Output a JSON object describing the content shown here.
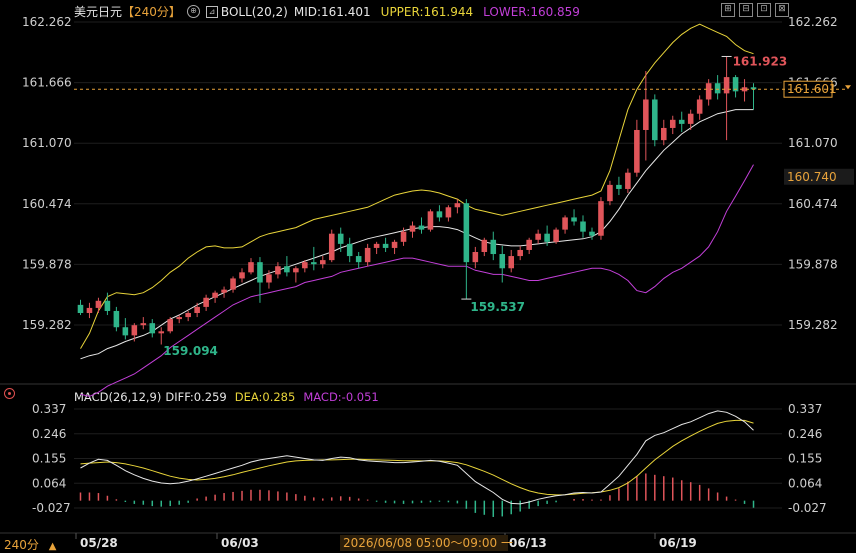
{
  "header": {
    "symbol": "美元日元",
    "period": "【240分】",
    "indicator": "BOLL(20,2)",
    "mid_label": "MID:",
    "mid_value": "161.401",
    "upper_label": "UPPER:",
    "upper_value": "161.944",
    "lower_label": "LOWER:",
    "lower_value": "160.859",
    "mid_color": "#e6e6e6",
    "upper_color": "#e8d43a",
    "lower_color": "#c23fd8"
  },
  "window_buttons": [
    "⊞",
    "⊟",
    "⊡",
    "⊠"
  ],
  "price_axis": {
    "ticks": [
      "162.262",
      "161.666",
      "161.070",
      "160.474",
      "159.878",
      "159.282"
    ],
    "tick_values": [
      162.262,
      161.666,
      161.07,
      160.474,
      159.878,
      159.282
    ],
    "current_price": "161.601",
    "lower_band_tag": "160.740"
  },
  "annotations": {
    "high": "161.923",
    "low_mid": "159.537",
    "low_left": "159.094"
  },
  "macd_header": {
    "name": "MACD(26,12,9)",
    "diff": "DIFF:0.259",
    "dea": "DEA:0.285",
    "macd": "MACD:-0.051"
  },
  "macd_axis": {
    "ticks": [
      "0.337",
      "0.246",
      "0.155",
      "0.064",
      "-0.027"
    ],
    "tick_values": [
      0.337,
      0.246,
      0.155,
      0.064,
      -0.027
    ]
  },
  "time_axis": {
    "labels": [
      "05/28",
      "06/03",
      "06/13",
      "06/19"
    ],
    "crosshair_label": "2026/06/08 05:00～09:00 一"
  },
  "bottom_left": {
    "period": "240分",
    "arrow": "▲"
  },
  "colors": {
    "up": "#e0555a",
    "down": "#2fb58a",
    "orange": "#e8a33b",
    "grid": "#1e1e1e"
  },
  "chart_data": {
    "type": "candlestick",
    "price_range": [
      159.0,
      162.3
    ],
    "candles": [
      [
        159.48,
        159.53,
        159.38,
        159.4
      ],
      [
        159.4,
        159.5,
        159.35,
        159.45
      ],
      [
        159.45,
        159.55,
        159.4,
        159.52
      ],
      [
        159.52,
        159.6,
        159.38,
        159.42
      ],
      [
        159.42,
        159.46,
        159.22,
        159.26
      ],
      [
        159.26,
        159.35,
        159.14,
        159.18
      ],
      [
        159.18,
        159.3,
        159.12,
        159.28
      ],
      [
        159.28,
        159.36,
        159.24,
        159.3
      ],
      [
        159.3,
        159.34,
        159.16,
        159.2
      ],
      [
        159.2,
        159.26,
        159.09,
        159.22
      ],
      [
        159.22,
        159.36,
        159.2,
        159.34
      ],
      [
        159.34,
        159.38,
        159.3,
        159.36
      ],
      [
        159.36,
        159.42,
        159.32,
        159.4
      ],
      [
        159.4,
        159.5,
        159.36,
        159.46
      ],
      [
        159.46,
        159.58,
        159.42,
        159.55
      ],
      [
        159.55,
        159.62,
        159.5,
        159.6
      ],
      [
        159.6,
        159.66,
        159.55,
        159.63
      ],
      [
        159.63,
        159.76,
        159.6,
        159.74
      ],
      [
        159.74,
        159.84,
        159.7,
        159.8
      ],
      [
        159.8,
        159.94,
        159.78,
        159.9
      ],
      [
        159.9,
        159.95,
        159.5,
        159.7
      ],
      [
        159.7,
        159.82,
        159.64,
        159.78
      ],
      [
        159.78,
        159.9,
        159.74,
        159.86
      ],
      [
        159.86,
        159.96,
        159.76,
        159.8
      ],
      [
        159.8,
        159.86,
        159.7,
        159.84
      ],
      [
        159.84,
        159.92,
        159.8,
        159.9
      ],
      [
        159.9,
        160.05,
        159.82,
        159.88
      ],
      [
        159.88,
        159.96,
        159.84,
        159.92
      ],
      [
        159.92,
        160.22,
        159.9,
        160.18
      ],
      [
        160.18,
        160.24,
        160.0,
        160.08
      ],
      [
        160.08,
        160.14,
        159.9,
        159.96
      ],
      [
        159.96,
        160.0,
        159.84,
        159.9
      ],
      [
        159.9,
        160.08,
        159.86,
        160.04
      ],
      [
        160.04,
        160.1,
        159.98,
        160.08
      ],
      [
        160.08,
        160.14,
        160.0,
        160.04
      ],
      [
        160.04,
        160.12,
        159.98,
        160.1
      ],
      [
        160.1,
        160.24,
        160.06,
        160.2
      ],
      [
        160.2,
        160.3,
        160.14,
        160.26
      ],
      [
        160.26,
        160.34,
        160.18,
        160.22
      ],
      [
        160.22,
        160.42,
        160.2,
        160.4
      ],
      [
        160.4,
        160.46,
        160.3,
        160.34
      ],
      [
        160.34,
        160.46,
        160.3,
        160.44
      ],
      [
        160.44,
        160.52,
        160.38,
        160.48
      ],
      [
        160.48,
        160.52,
        159.54,
        159.9
      ],
      [
        159.9,
        160.05,
        159.84,
        160.0
      ],
      [
        160.0,
        160.14,
        159.96,
        160.12
      ],
      [
        160.12,
        160.2,
        159.92,
        159.98
      ],
      [
        159.98,
        160.06,
        159.7,
        159.84
      ],
      [
        159.84,
        160.02,
        159.8,
        159.96
      ],
      [
        159.96,
        160.06,
        159.92,
        160.02
      ],
      [
        160.02,
        160.14,
        159.98,
        160.12
      ],
      [
        160.12,
        160.22,
        160.08,
        160.18
      ],
      [
        160.18,
        160.26,
        160.06,
        160.1
      ],
      [
        160.1,
        160.24,
        160.08,
        160.22
      ],
      [
        160.22,
        160.36,
        160.18,
        160.34
      ],
      [
        160.34,
        160.42,
        160.26,
        160.3
      ],
      [
        160.3,
        160.36,
        160.14,
        160.2
      ],
      [
        160.2,
        160.24,
        160.12,
        160.16
      ],
      [
        160.16,
        160.54,
        160.12,
        160.5
      ],
      [
        160.5,
        160.7,
        160.46,
        160.66
      ],
      [
        160.66,
        160.74,
        160.56,
        160.62
      ],
      [
        160.62,
        160.82,
        160.58,
        160.78
      ],
      [
        160.78,
        161.3,
        160.74,
        161.2
      ],
      [
        161.2,
        161.78,
        160.9,
        161.5
      ],
      [
        161.5,
        161.55,
        161.04,
        161.1
      ],
      [
        161.1,
        161.3,
        161.05,
        161.22
      ],
      [
        161.22,
        161.34,
        161.16,
        161.3
      ],
      [
        161.3,
        161.38,
        161.18,
        161.26
      ],
      [
        161.26,
        161.4,
        161.2,
        161.36
      ],
      [
        161.36,
        161.54,
        161.3,
        161.5
      ],
      [
        161.5,
        161.7,
        161.44,
        161.66
      ],
      [
        161.66,
        161.74,
        161.5,
        161.56
      ],
      [
        161.56,
        161.92,
        161.1,
        161.72
      ],
      [
        161.72,
        161.74,
        161.52,
        161.58
      ],
      [
        161.58,
        161.7,
        161.48,
        161.62
      ],
      [
        161.62,
        161.66,
        161.4,
        161.6
      ]
    ],
    "upper": [
      159.05,
      159.2,
      159.42,
      159.56,
      159.6,
      159.59,
      159.58,
      159.6,
      159.65,
      159.72,
      159.8,
      159.86,
      159.94,
      160.0,
      160.05,
      160.06,
      160.04,
      160.04,
      160.05,
      160.1,
      160.15,
      160.18,
      160.2,
      160.22,
      160.24,
      160.28,
      160.32,
      160.34,
      160.36,
      160.38,
      160.4,
      160.42,
      160.44,
      160.48,
      160.52,
      160.56,
      160.58,
      160.6,
      160.61,
      160.6,
      160.58,
      160.55,
      160.52,
      160.46,
      160.42,
      160.4,
      160.38,
      160.36,
      160.38,
      160.4,
      160.42,
      160.44,
      160.46,
      160.48,
      160.5,
      160.52,
      160.54,
      160.56,
      160.6,
      160.8,
      161.1,
      161.4,
      161.6,
      161.74,
      161.86,
      161.96,
      162.06,
      162.14,
      162.2,
      162.24,
      162.2,
      162.16,
      162.12,
      162.04,
      161.98,
      161.95
    ],
    "mid": [
      158.95,
      158.98,
      159.0,
      159.05,
      159.08,
      159.12,
      159.15,
      159.18,
      159.22,
      159.28,
      159.34,
      159.38,
      159.43,
      159.48,
      159.52,
      159.56,
      159.6,
      159.64,
      159.68,
      159.72,
      159.76,
      159.79,
      159.82,
      159.85,
      159.88,
      159.91,
      159.94,
      159.97,
      160.0,
      160.04,
      160.07,
      160.1,
      160.13,
      160.15,
      160.17,
      160.19,
      160.21,
      160.23,
      160.24,
      160.25,
      160.25,
      160.24,
      160.22,
      160.18,
      160.14,
      160.1,
      160.08,
      160.07,
      160.06,
      160.06,
      160.07,
      160.08,
      160.09,
      160.1,
      160.11,
      160.12,
      160.13,
      160.15,
      160.2,
      160.3,
      160.42,
      160.56,
      160.68,
      160.8,
      160.9,
      161.0,
      161.08,
      161.16,
      161.22,
      161.28,
      161.32,
      161.36,
      161.38,
      161.4,
      161.4,
      161.4
    ],
    "lower": [
      158.6,
      158.58,
      158.62,
      158.68,
      158.72,
      158.76,
      158.8,
      158.86,
      158.92,
      158.98,
      159.06,
      159.12,
      159.18,
      159.24,
      159.3,
      159.36,
      159.42,
      159.48,
      159.52,
      159.56,
      159.58,
      159.6,
      159.62,
      159.64,
      159.66,
      159.7,
      159.72,
      159.74,
      159.76,
      159.8,
      159.82,
      159.84,
      159.86,
      159.88,
      159.9,
      159.92,
      159.94,
      159.94,
      159.92,
      159.9,
      159.88,
      159.86,
      159.86,
      159.86,
      159.82,
      159.8,
      159.78,
      159.78,
      159.76,
      159.74,
      159.72,
      159.72,
      159.74,
      159.76,
      159.78,
      159.8,
      159.82,
      159.84,
      159.84,
      159.82,
      159.78,
      159.72,
      159.62,
      159.6,
      159.66,
      159.74,
      159.8,
      159.84,
      159.9,
      159.96,
      160.05,
      160.2,
      160.4,
      160.55,
      160.7,
      160.86
    ],
    "macd": {
      "range": [
        -0.06,
        0.35
      ],
      "diff": [
        0.12,
        0.138,
        0.152,
        0.148,
        0.13,
        0.11,
        0.095,
        0.082,
        0.072,
        0.065,
        0.062,
        0.065,
        0.072,
        0.08,
        0.09,
        0.1,
        0.11,
        0.12,
        0.13,
        0.142,
        0.15,
        0.155,
        0.16,
        0.165,
        0.16,
        0.155,
        0.15,
        0.148,
        0.155,
        0.16,
        0.158,
        0.15,
        0.146,
        0.144,
        0.142,
        0.14,
        0.14,
        0.142,
        0.145,
        0.148,
        0.145,
        0.138,
        0.13,
        0.1,
        0.07,
        0.05,
        0.03,
        0.005,
        -0.01,
        -0.012,
        -0.005,
        0.005,
        0.012,
        0.018,
        0.022,
        0.028,
        0.03,
        0.028,
        0.032,
        0.06,
        0.09,
        0.13,
        0.17,
        0.22,
        0.24,
        0.25,
        0.265,
        0.28,
        0.29,
        0.305,
        0.32,
        0.33,
        0.325,
        0.31,
        0.29,
        0.259
      ],
      "dea": [
        0.135,
        0.138,
        0.14,
        0.142,
        0.14,
        0.135,
        0.128,
        0.12,
        0.11,
        0.1,
        0.09,
        0.083,
        0.078,
        0.076,
        0.078,
        0.082,
        0.088,
        0.095,
        0.104,
        0.112,
        0.12,
        0.128,
        0.135,
        0.142,
        0.146,
        0.148,
        0.149,
        0.15,
        0.15,
        0.151,
        0.152,
        0.152,
        0.151,
        0.15,
        0.149,
        0.148,
        0.147,
        0.147,
        0.146,
        0.146,
        0.146,
        0.144,
        0.14,
        0.132,
        0.12,
        0.108,
        0.094,
        0.078,
        0.062,
        0.048,
        0.036,
        0.028,
        0.023,
        0.021,
        0.022,
        0.024,
        0.027,
        0.029,
        0.032,
        0.038,
        0.048,
        0.065,
        0.09,
        0.12,
        0.15,
        0.175,
        0.2,
        0.22,
        0.238,
        0.255,
        0.27,
        0.284,
        0.292,
        0.295,
        0.295,
        0.285
      ],
      "hist": [
        0.03,
        0.03,
        0.028,
        0.018,
        0.005,
        -0.005,
        -0.012,
        -0.015,
        -0.02,
        -0.022,
        -0.02,
        -0.015,
        -0.008,
        0.008,
        0.015,
        0.022,
        0.028,
        0.032,
        0.036,
        0.04,
        0.04,
        0.038,
        0.034,
        0.03,
        0.024,
        0.018,
        0.012,
        0.008,
        0.012,
        0.016,
        0.014,
        0.008,
        0.004,
        -0.004,
        -0.008,
        -0.01,
        -0.012,
        -0.01,
        -0.008,
        -0.006,
        -0.004,
        -0.006,
        -0.01,
        -0.03,
        -0.045,
        -0.052,
        -0.06,
        -0.058,
        -0.05,
        -0.04,
        -0.03,
        -0.02,
        -0.012,
        -0.006,
        0.0,
        0.006,
        0.006,
        0.004,
        0.004,
        0.02,
        0.045,
        0.07,
        0.09,
        0.1,
        0.095,
        0.09,
        0.085,
        0.075,
        0.068,
        0.058,
        0.045,
        0.03,
        0.015,
        0.004,
        -0.012,
        -0.026
      ]
    }
  }
}
